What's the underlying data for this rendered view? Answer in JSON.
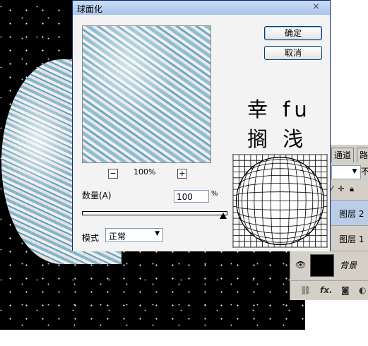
{
  "dialog": {
    "title": "球面化",
    "ok_label": "确定",
    "cancel_label": "取消",
    "zoom": {
      "minus": "−",
      "plus": "+",
      "level": "100%"
    },
    "amount": {
      "label": "数量(A)",
      "value": "100",
      "unit": "%"
    },
    "mode": {
      "label": "模式",
      "value": "正常"
    }
  },
  "watermark": "幸 fu 搁 浅",
  "layers_panel": {
    "tabs": [
      "通道",
      "路"
    ],
    "after_combo": "不",
    "layers": [
      {
        "name": "图层 2",
        "selected": true
      },
      {
        "name": "图层 1",
        "selected": false
      },
      {
        "name": "背景",
        "selected": false
      }
    ],
    "bottom_icons": [
      "link-icon",
      "fx-icon",
      "mask-icon",
      "adjustment-icon"
    ],
    "fx_label": "fx."
  },
  "colors": {
    "title_bar": "#a9c5ea",
    "dialog_bg": "#f3f3f3",
    "selected_layer": "#b9cee6"
  }
}
